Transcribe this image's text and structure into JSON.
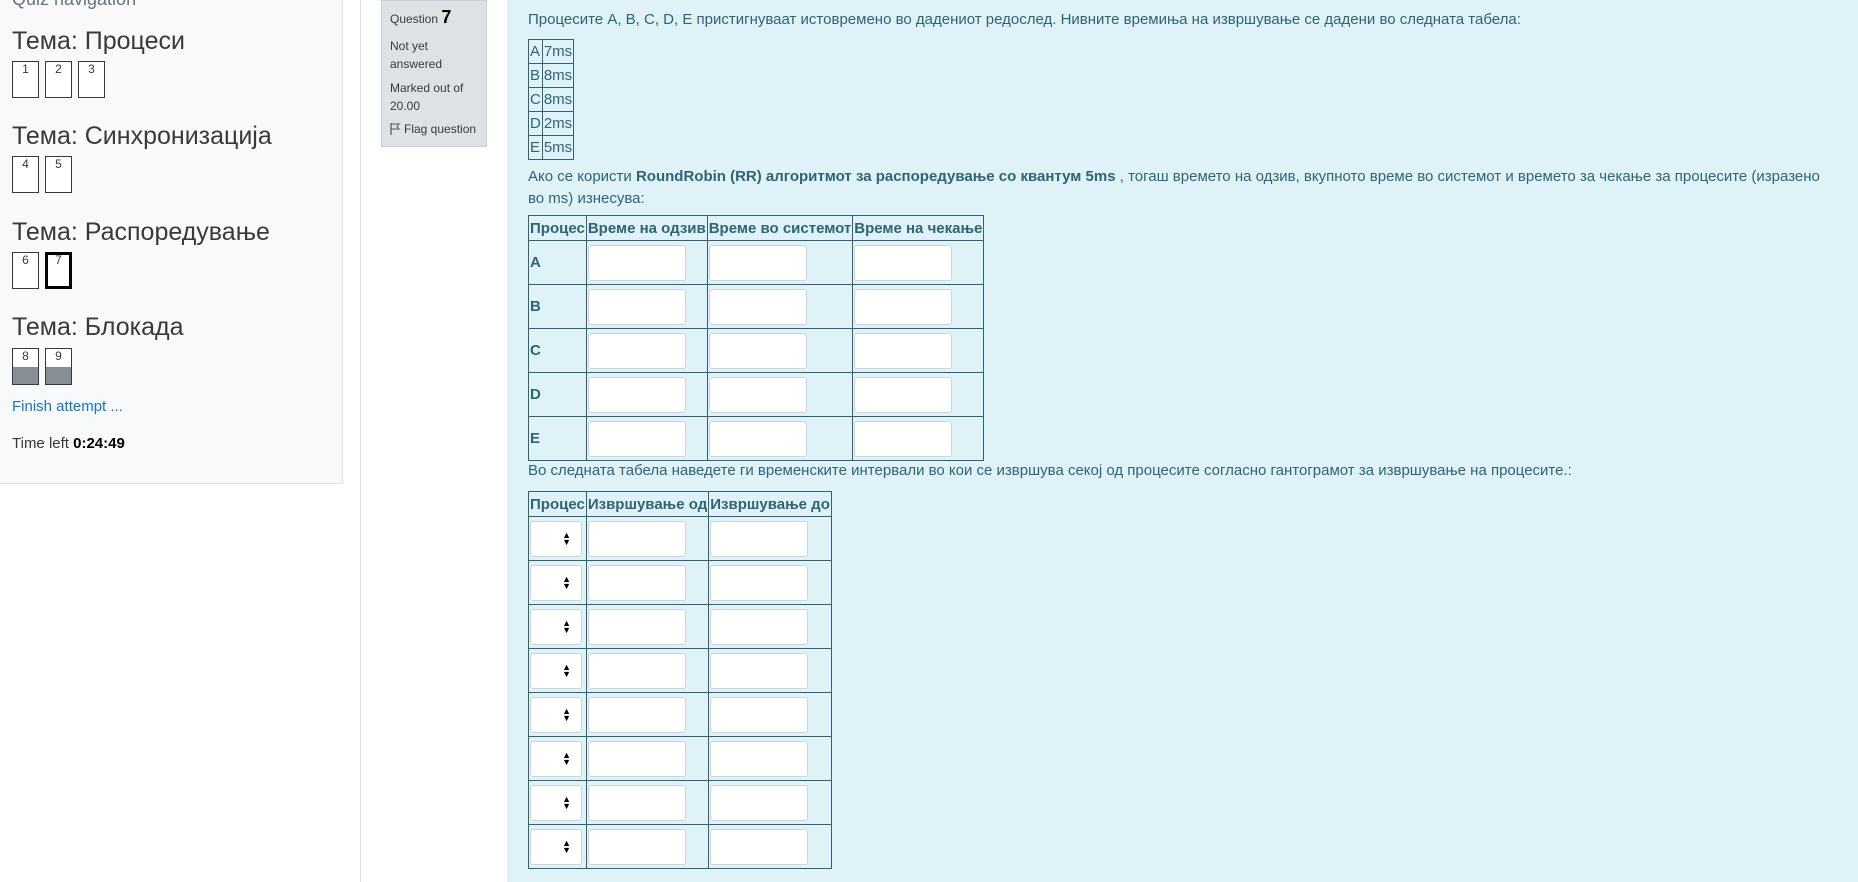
{
  "nav": {
    "heading": "Quiz navigation",
    "sections": [
      {
        "title": "Тема: Процеси",
        "questions": [
          "1",
          "2",
          "3"
        ]
      },
      {
        "title": "Тема: Синхронизација",
        "questions": [
          "4",
          "5"
        ]
      },
      {
        "title": "Тема: Распоредување",
        "questions": [
          "6",
          "7"
        ]
      },
      {
        "title": "Тема: Блокада",
        "questions": [
          "8",
          "9"
        ]
      }
    ],
    "finish_link": "Finish attempt ...",
    "time_left_label": "Time left",
    "time_left_value": "0:24:49"
  },
  "question_info": {
    "label": "Question",
    "number": "7",
    "state": "Not yet answered",
    "grade": "Marked out of 20.00",
    "flag": "Flag question"
  },
  "content": {
    "intro": "Процесите A, B, C, D, E пристигнуваат истовремено во дадениот редослед. Нивните времиња на извршување се дадени во следната табела:",
    "bursts": [
      {
        "p": "A",
        "t": "7ms"
      },
      {
        "p": "B",
        "t": "8ms"
      },
      {
        "p": "C",
        "t": "8ms"
      },
      {
        "p": "D",
        "t": "2ms"
      },
      {
        "p": "E",
        "t": "5ms"
      }
    ],
    "para2_pre": "Ако се користи ",
    "para2_bold": "RoundRobin (RR) алгоритмот за распоредување со квантум 5ms",
    "para2_post": " , тогаш времето на одзив, вкупното време во системот и времето за чекање за процесите (изразено во ms) изнесува:",
    "table1_headers": [
      "Процес",
      "Време на одзив",
      "Време во системот",
      "Време на чекање"
    ],
    "table1_rows": [
      "A",
      "B",
      "C",
      "D",
      "E"
    ],
    "para3": "Во следната табела наведете ги временските интервали во кои се извршува секој од процесите согласно гантограмот за извршување на процесите.:",
    "table2_headers": [
      "Процес",
      "Извршување од",
      "Извршување до"
    ],
    "table2_row_count": 8
  }
}
